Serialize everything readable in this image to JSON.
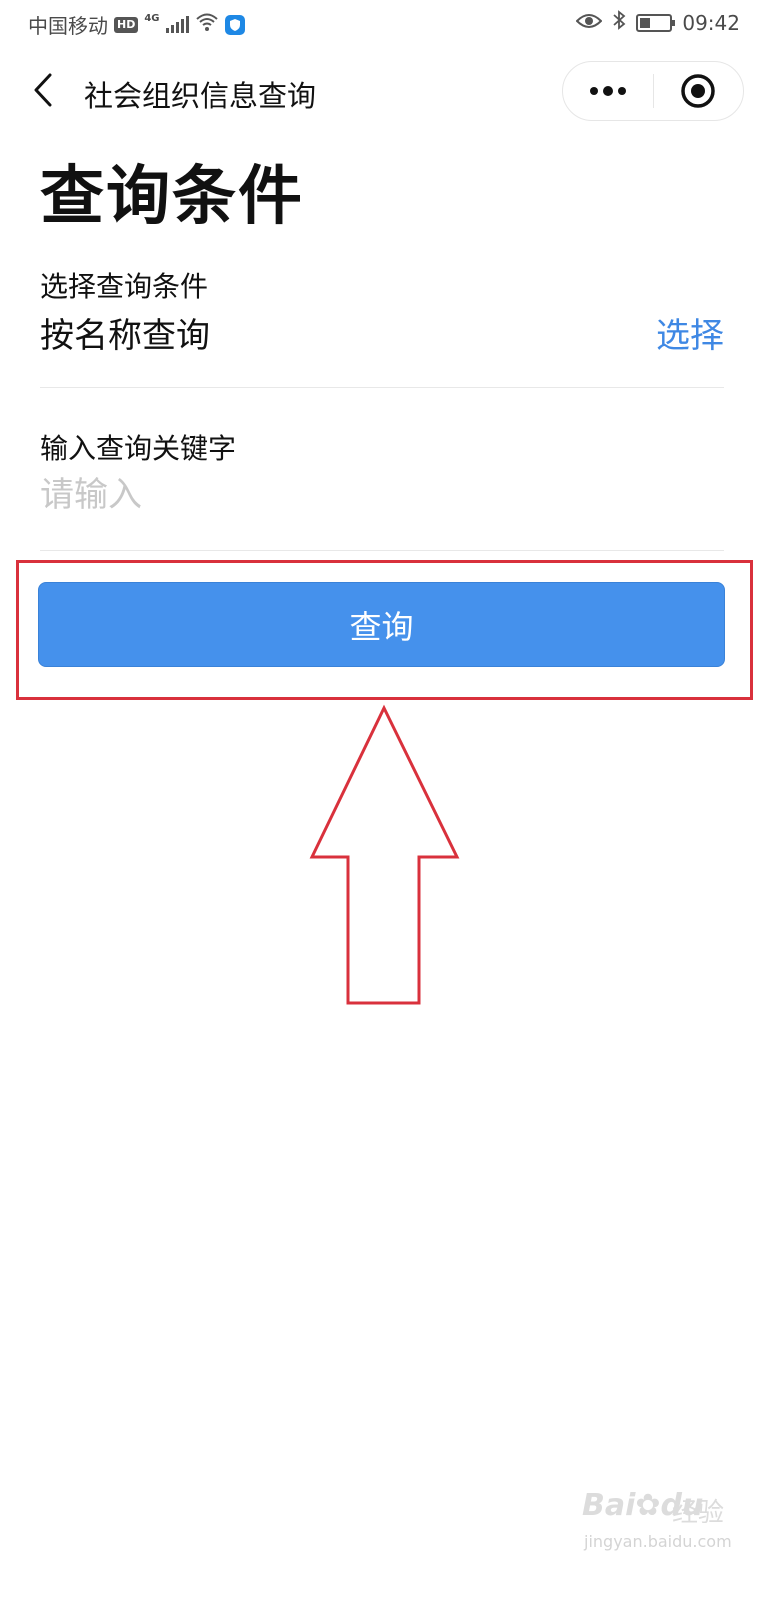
{
  "status_bar": {
    "carrier": "中国移动",
    "hd_badge": "HD",
    "network": "4G",
    "time": "09:42",
    "battery_level": 0.35,
    "icons": [
      "hd-icon",
      "signal-icon",
      "wifi-icon",
      "shield-icon",
      "eye-icon",
      "bluetooth-icon",
      "battery-icon"
    ]
  },
  "nav": {
    "title": "社会组织信息查询",
    "back_icon": "chevron-left-icon",
    "more_icon": "more-dots-icon",
    "close_icon": "target-close-icon"
  },
  "page": {
    "title": "查询条件"
  },
  "condition": {
    "label": "选择查询条件",
    "value": "按名称查询",
    "select_link": "选择"
  },
  "keyword": {
    "label": "输入查询关键字",
    "placeholder": "请输入",
    "value": ""
  },
  "query_button": {
    "label": "查询"
  },
  "colors": {
    "accent": "#3f88e4",
    "button_bg": "#4591ec",
    "annotation_red": "#d9313c",
    "placeholder": "#c8c8c8"
  },
  "watermark": {
    "brand": "Bai",
    "brand_suffix": "du",
    "cn": "经验",
    "url": "jingyan.baidu.com"
  }
}
